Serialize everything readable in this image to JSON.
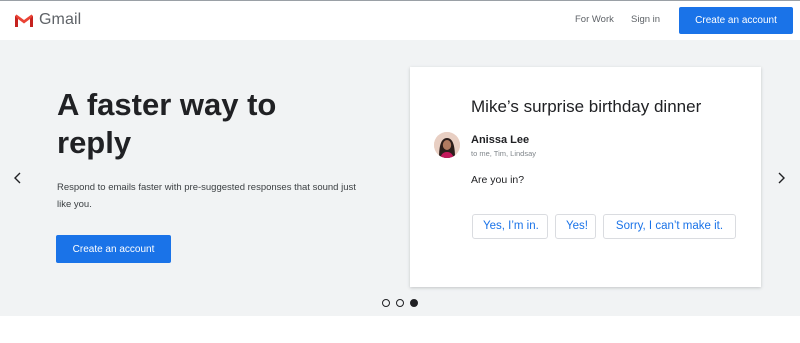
{
  "header": {
    "logo_text": "Gmail",
    "nav": {
      "for_work": "For Work",
      "sign_in": "Sign in"
    },
    "cta_label": "Create an account"
  },
  "hero": {
    "headline": "A faster way to reply",
    "subtext": "Respond to emails faster with pre-suggested responses that sound just like you.",
    "cta_label": "Create an account"
  },
  "email_card": {
    "subject": "Mike’s surprise birthday dinner",
    "sender": "Anissa Lee",
    "recipients": "to me, Tim, Lindsay",
    "body": "Are you in?",
    "smart_replies": [
      "Yes, I’m in.",
      "Yes!",
      "Sorry, I can’t make it."
    ]
  },
  "carousel": {
    "slide_count": 3,
    "active_slide": 3
  },
  "colors": {
    "accent": "#1a73e8",
    "background": "#f1f3f4",
    "text": "#202124",
    "muted": "#5f6368"
  },
  "icons": {
    "logo": "gmail-m-icon",
    "prev": "chevron-left-icon",
    "next": "chevron-right-icon"
  }
}
